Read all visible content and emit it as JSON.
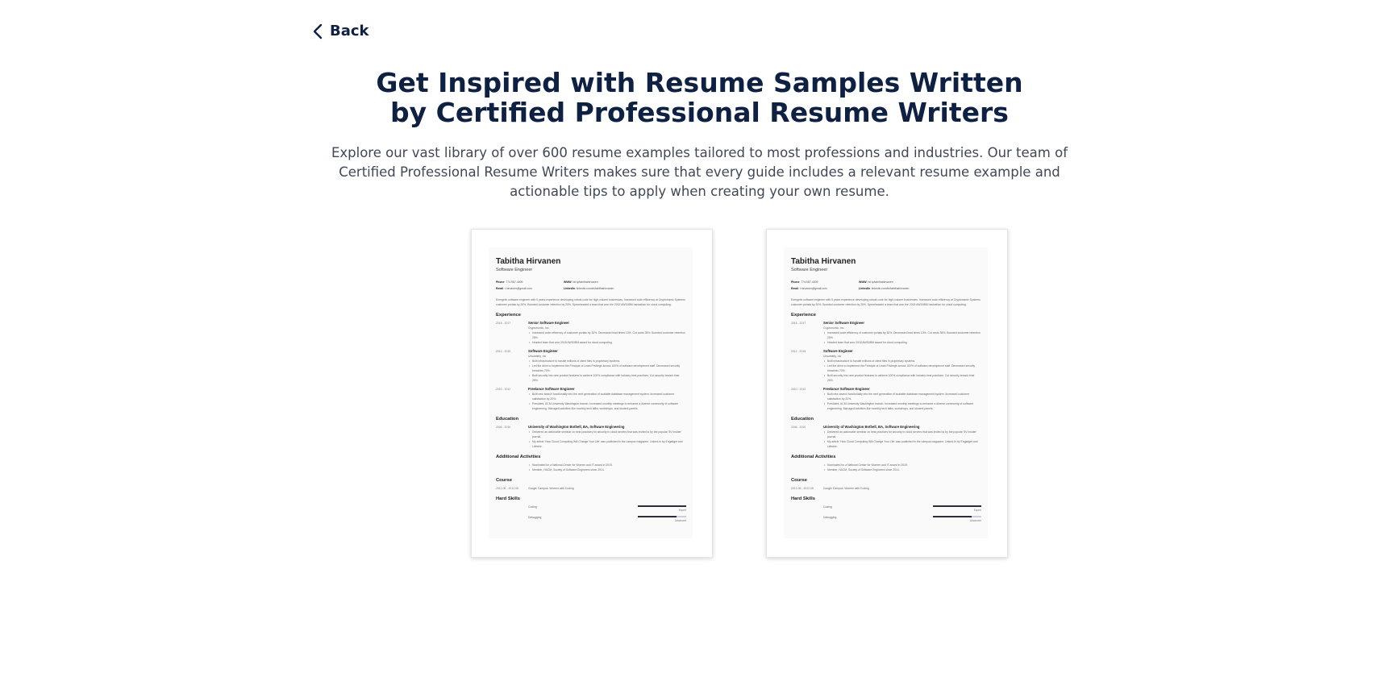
{
  "nav": {
    "back_label": "Back"
  },
  "header": {
    "title_line1": "Get Inspired with Resume Samples Written",
    "title_line2": "by Certified Professional Resume Writers",
    "subtitle": "Explore our vast library of over 600 resume examples tailored to most professions and industries. Our team of Certified Professional Resume Writers makes sure that every guide includes a relevant resume example and actionable tips to apply when creating your own resume."
  },
  "resume": {
    "name": "Tabitha Hirvanen",
    "job_title": "Software Engineer",
    "phone_label": "Phone",
    "phone": "774-987-4009",
    "www_label": "WWW",
    "www": "bit.ly/tabithahirvanen",
    "email_label": "Email",
    "email": "t.hirvanen@gmail.com",
    "linkedin_label": "LinkedIn",
    "linkedin": "linkedin.com/in/tabithahirvanen",
    "summary": "Energetic software engineer with 5 years experience developing robust code for high-volume businesses. Increased code efficiency at Cryptonomic Systems customer portals by 30%. Boosted customer retention by 25%. Spearheaded a team that won the 2018 AWS/IBM hackathon for cloud computing.",
    "sections": {
      "experience": "Experience",
      "education": "Education",
      "activities": "Additional Activities",
      "course": "Course",
      "skills": "Hard Skills"
    },
    "experience": [
      {
        "dates": "2015 - 2017",
        "title": "Senior Software Engineer",
        "company": "Cryptonomic, Inc.",
        "bullets": [
          "Increased code efficiency of customer portals by 30%. Decreased lead times 10%. Cut costs 35%. Boosted customer retention 25%.",
          "Headed team that won 2018 AWS/IBM award for cloud computing."
        ]
      },
      {
        "dates": "2012 - 2015",
        "title": "Software Engineer",
        "company": "Unsubtlety, Inc.",
        "bullets": [
          "Built infrastructure to handle millions of client files in proprietary systems.",
          "Led the drive to implement the Principle of Least Privilege across 100% of software development staff. Decreased security breaches 70%.",
          "Built security into new product features to achieve 100% compliance with industry best practices. Cut security breach time 25%."
        ]
      },
      {
        "dates": "2010 - 2012",
        "title": "Freelance Software Engineer",
        "company": "",
        "bullets": [
          "Built new search functionality into the next generation of scalable database management system. Increased customer satisfaction by 20%.",
          "President, ACM University Washington branch. Increased monthly meetings to enhance a diverse community of software engineering. Managed activities like monthly tech talks, workshops, and student panels."
        ]
      }
    ],
    "education": [
      {
        "dates": "2006 - 2010",
        "title": "University of Washington Bothell, BA, Software Engineering",
        "bullets": [
          "Delivered an actionable seminar on best practices for security in cloud servers that was invited to by the popular '5V Insider' journal.",
          "My article 'How Cloud Computing Will Change Your Life' was published in the campus magazine. Linked-In by Engadget and Lifewire."
        ]
      }
    ],
    "activities": [
      "Nominated for a National Center for Women and IT award in 2015.",
      "Member, HACM, Society of Software Engineers since 2014."
    ],
    "course": {
      "dates": "2012-06 - 2012-08",
      "text": "Google Campus: Women with Coding"
    },
    "skills": [
      {
        "name": "Coding",
        "level": "Expert",
        "fill": 1.0
      },
      {
        "name": "Debugging",
        "level": "Advanced",
        "fill": 0.8
      }
    ]
  }
}
